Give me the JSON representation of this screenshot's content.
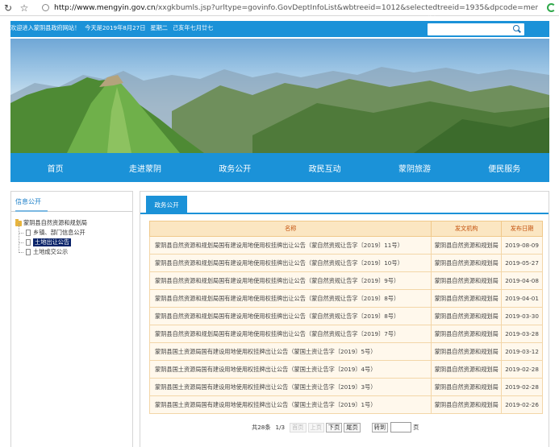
{
  "browser": {
    "url_host": "http://www.mengyin.gov.cn",
    "url_path": "/xxgkbumls.jsp?urltype=govinfo.GovDeptInfoList&wbtreeid=1012&selectedtreeid=1935&dpcode=mengyinxian"
  },
  "topbar": {
    "welcome": "欢迎进入蒙阴县政府网站！",
    "date": "今天是2019年8月27日",
    "weekday": "星期二",
    "lunar": "己亥年七月廿七",
    "search_placeholder": "",
    "search_label": "搜索"
  },
  "nav": {
    "items": [
      "首页",
      "走进蒙阴",
      "政务公开",
      "政民互动",
      "蒙阴旅游",
      "便民服务"
    ]
  },
  "left": {
    "title": "信息公开",
    "root": "蒙阴县自然资源和规划局",
    "children": [
      "乡镇、部门信息公开",
      "土地出让公告",
      "土地成交公示"
    ]
  },
  "right": {
    "tab": "政务公开",
    "headers": {
      "name": "名称",
      "org": "发文机构",
      "date": "发布日期"
    },
    "rows": [
      {
        "name": "蒙阴县自然资源和规划局国有建设用地使用权挂牌出让公告（蒙自然资规让告字〔2019〕11号）",
        "org": "蒙阴县自然资源和规划局",
        "date": "2019-08-09"
      },
      {
        "name": "蒙阴县自然资源和规划局国有建设用地使用权挂牌出让公告（蒙自然资规让告字〔2019〕10号）",
        "org": "蒙阴县自然资源和规划局",
        "date": "2019-05-27"
      },
      {
        "name": "蒙阴县自然资源和规划局国有建设用地使用权挂牌出让公告（蒙自然资规让告字〔2019〕9号）",
        "org": "蒙阴县自然资源和规划局",
        "date": "2019-04-08"
      },
      {
        "name": "蒙阴县自然资源和规划局国有建设用地使用权挂牌出让公告（蒙自然资规让告字〔2019〕8号）",
        "org": "蒙阴县自然资源和规划局",
        "date": "2019-04-01"
      },
      {
        "name": "蒙阴县自然资源和规划局国有建设用地使用权挂牌出让公告（蒙自然资规让告字〔2019〕8号）",
        "org": "蒙阴县自然资源和规划局",
        "date": "2019-03-30"
      },
      {
        "name": "蒙阴县自然资源和规划局国有建设用地使用权挂牌出让公告（蒙自然资规让告字〔2019〕7号）",
        "org": "蒙阴县自然资源和规划局",
        "date": "2019-03-28"
      },
      {
        "name": "蒙阴县国土资源局国有建设用地使用权挂牌出让公告（蒙国土资让告字〔2019〕5号）",
        "org": "蒙阴县自然资源和规划局",
        "date": "2019-03-12"
      },
      {
        "name": "蒙阴县国土资源局国有建设用地使用权挂牌出让公告（蒙国土资让告字〔2019〕4号）",
        "org": "蒙阴县自然资源和规划局",
        "date": "2019-02-28"
      },
      {
        "name": "蒙阴县国土资源局国有建设用地使用权挂牌出让公告（蒙国土资让告字〔2019〕3号）",
        "org": "蒙阴县自然资源和规划局",
        "date": "2019-02-28"
      },
      {
        "name": "蒙阴县国土资源局国有建设用地使用权挂牌出让公告（蒙国土资让告字〔2019〕1号）",
        "org": "蒙阴县自然资源和规划局",
        "date": "2019-02-26"
      }
    ]
  },
  "pager": {
    "total": "共28条",
    "page": "1/3",
    "first": "首页",
    "prev": "上页",
    "next": "下页",
    "last": "尾页",
    "go": "转到",
    "page_unit": "页"
  }
}
